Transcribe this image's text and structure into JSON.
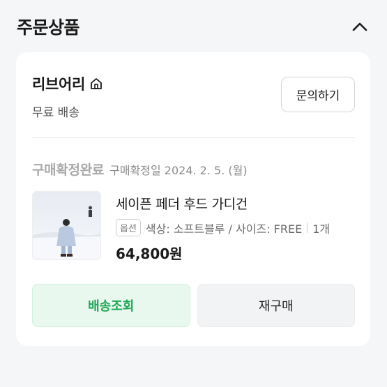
{
  "section": {
    "title": "주문상품"
  },
  "shop": {
    "name": "리브어리",
    "shipping": "무료 배송",
    "inquiry_label": "문의하기"
  },
  "order": {
    "status": "구매확정완료",
    "confirm_date": "구매확정일 2024. 2. 5. (월)"
  },
  "product": {
    "name": "세이픈 페더 후드 가디건",
    "option_badge": "옵션",
    "option_text": "색상: 소프트블루 / 사이즈: FREE",
    "quantity": "1개",
    "price": "64,800원"
  },
  "actions": {
    "track_label": "배송조회",
    "reorder_label": "재구매"
  },
  "colors": {
    "accent_green": "#1fa855",
    "status_gray": "#a8a8a8"
  }
}
